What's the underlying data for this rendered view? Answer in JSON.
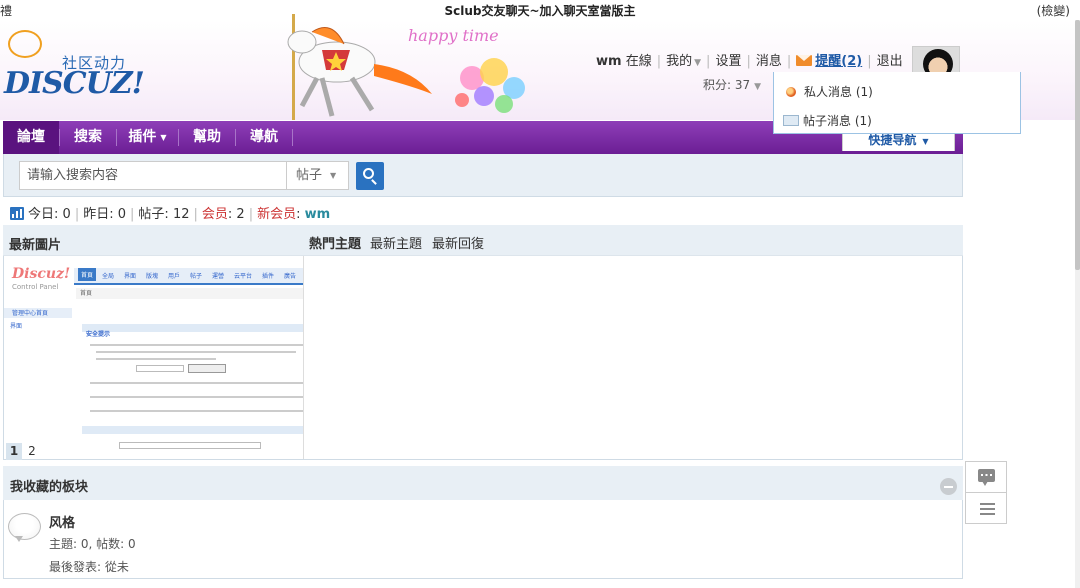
{
  "window": {
    "title_left": "禮",
    "title": "Sclub交友聊天~加入聊天室當版主",
    "title_right": "(檢變)"
  },
  "header": {
    "logo_tagline": "社区动力",
    "logo_wordmark": "DISCUZ!",
    "banner_text": "happy time"
  },
  "user_nav": {
    "username": "wm",
    "online_status": "在線",
    "my_label": "我的",
    "settings_label": "设置",
    "messages_label": "消息",
    "notices_label": "提醒(2)",
    "logout_label": "退出",
    "credits_label": "积分: 37"
  },
  "notice_menu": {
    "items": [
      {
        "label": "私人消息 (1)",
        "icon": "orange-dot-icon"
      },
      {
        "label": "帖子消息 (1)",
        "icon": "envelope-icon"
      }
    ]
  },
  "main_nav": {
    "items": [
      {
        "label": "論壇",
        "active": true
      },
      {
        "label": "搜索",
        "active": false
      },
      {
        "label": "插件",
        "active": false,
        "has_dropdown": true
      },
      {
        "label": "幫助",
        "active": false
      },
      {
        "label": "導航",
        "active": false
      }
    ],
    "quick_nav_label": "快捷导航"
  },
  "search": {
    "placeholder": "请输入搜索内容",
    "type_value": "帖子"
  },
  "stats": {
    "today_label": "今日",
    "today": "0",
    "yesterday_label": "昨日",
    "yesterday": "0",
    "posts_label": "帖子",
    "posts": "12",
    "members_label": "会员",
    "members": "2",
    "new_member_label": "新会员",
    "new_member": "wm"
  },
  "pictures": {
    "title": "最新圖片",
    "pages": [
      "1",
      "2"
    ],
    "thumbnail": {
      "logo": "Discuz!",
      "logo_sub": "Control Panel",
      "tabs": [
        "首頁",
        "全局",
        "界面",
        "版塊",
        "用戶",
        "帖子",
        "運營",
        "云平台",
        "插件",
        "廣告"
      ],
      "breadcrumb": "首頁",
      "side_items": [
        "管理中心首頁",
        "界面"
      ],
      "section": "安全提示"
    }
  },
  "topics": {
    "tabs": [
      {
        "label": "熱門主題",
        "active": true
      },
      {
        "label": "最新主題",
        "active": false
      },
      {
        "label": "最新回復",
        "active": false
      }
    ]
  },
  "favorites": {
    "title": "我收藏的板块",
    "forums": [
      {
        "name": "风格",
        "stats": "主題: 0, 帖数: 0",
        "last_post": "最後發表: 從未"
      }
    ]
  },
  "colors": {
    "nav_purple": "#7b2ea6",
    "link_blue": "#1f5aa6",
    "panel_bg": "#e8eff5",
    "accent_red": "#cc3333"
  }
}
